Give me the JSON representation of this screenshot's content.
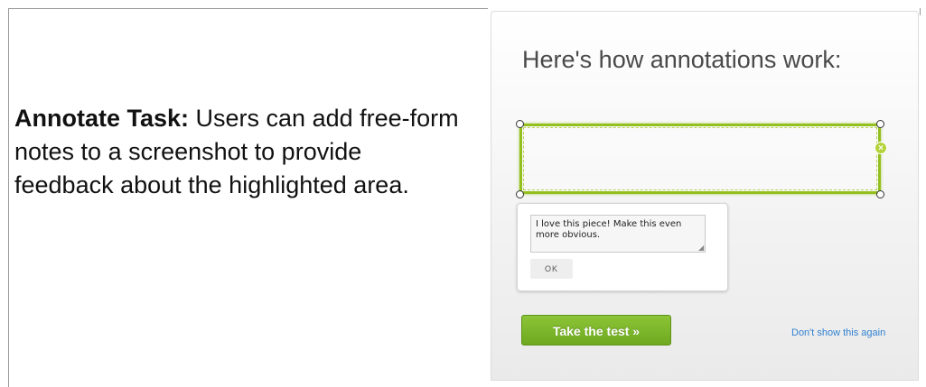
{
  "description": {
    "label": "Annotate Task:",
    "text": " Users can add free-form notes to a screenshot to provide feedback about the highlighted area."
  },
  "modal": {
    "title": "Here's how annotations work:",
    "note": {
      "text": "I love this piece! Make this even more obvious.",
      "ok_label": "OK"
    },
    "take_test_label": "Take the test »",
    "dont_show_label": "Don't show this again"
  },
  "colors": {
    "accent_green": "#93c01f",
    "button_green": "#7db52b",
    "link_blue": "#2f80d1"
  },
  "icons": {
    "close": "close-icon",
    "resize": "resize-grip-icon"
  }
}
